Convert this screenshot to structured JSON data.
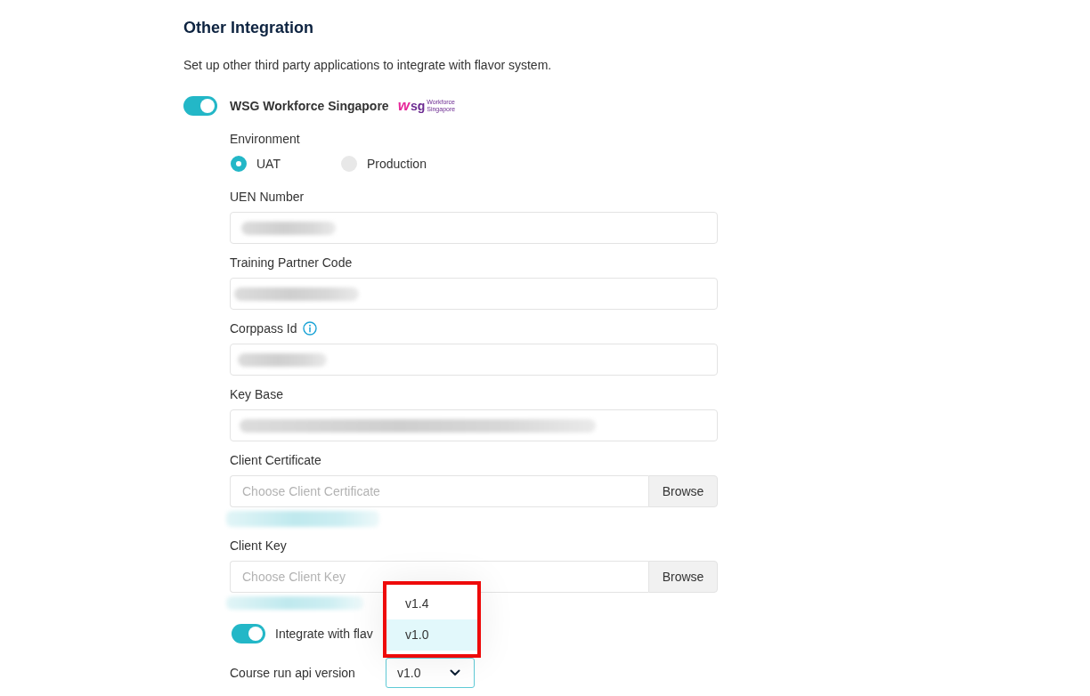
{
  "section": {
    "title": "Other Integration",
    "description": "Set up other third party applications to integrate with flavor system."
  },
  "integration": {
    "enabled": true,
    "name": "WSG Workforce Singapore",
    "logo": {
      "mark": "w",
      "text": "sg",
      "tagline": [
        "Workforce",
        "Singapore"
      ]
    }
  },
  "environment": {
    "label": "Environment",
    "options": [
      {
        "label": "UAT",
        "selected": true
      },
      {
        "label": "Production",
        "selected": false
      }
    ]
  },
  "fields": [
    {
      "kind": "text",
      "label": "UEN Number",
      "info": false,
      "redacted": true
    },
    {
      "kind": "text",
      "label": "Training Partner Code",
      "info": false,
      "redacted": true
    },
    {
      "kind": "text",
      "label": "Corppass Id",
      "info": true,
      "redacted": true
    },
    {
      "kind": "text",
      "label": "Key Base",
      "info": false,
      "redacted": true
    },
    {
      "kind": "file",
      "label": "Client Certificate",
      "placeholder": "Choose Client Certificate",
      "button": "Browse",
      "redacted": true
    },
    {
      "kind": "file",
      "label": "Client Key",
      "placeholder": "Choose Client Key",
      "button": "Browse",
      "redacted": true
    }
  ],
  "flavor_integration": {
    "enabled": true,
    "label": "Integrate with flav"
  },
  "course_run_api_version": {
    "label": "Course run api version",
    "value": "v1.0",
    "expanded": true,
    "highlighted": true,
    "options": [
      {
        "label": "v1.4",
        "selected": false
      },
      {
        "label": "v1.0",
        "selected": true
      }
    ]
  }
}
